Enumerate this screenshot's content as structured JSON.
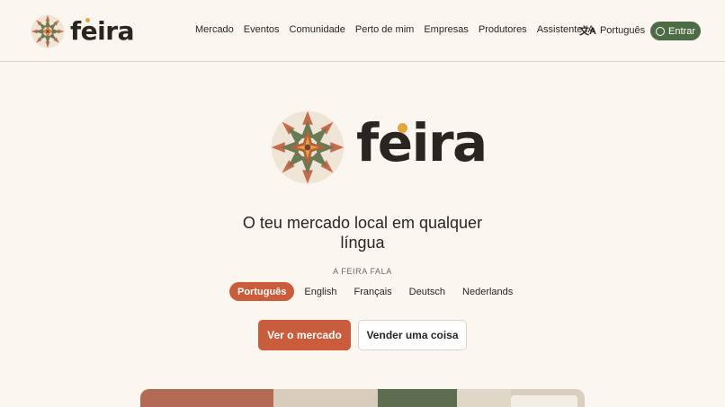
{
  "brand": {
    "name": "feira"
  },
  "nav": {
    "items": [
      "Mercado",
      "Eventos",
      "Comunidade",
      "Perto de mim",
      "Empresas",
      "Produtores",
      "Assistente IA"
    ]
  },
  "language_switch": {
    "label": "Português",
    "icon": "translate-icon"
  },
  "login": {
    "label": "Entrar",
    "icon": "user-circle-icon"
  },
  "hero": {
    "tagline": "O teu mercado local em qualquer língua",
    "speaks_label": "A FEIRA FALA",
    "languages": [
      "Português",
      "English",
      "Français",
      "Deutsch",
      "Nederlands"
    ],
    "active_language": "Português",
    "primary_cta": "Ver o mercado",
    "secondary_cta": "Vender uma coisa"
  },
  "colors": {
    "background": "#fbf6ef",
    "accent": "#c85c3b",
    "green": "#4d6b45",
    "dot": "#e2a43b"
  }
}
